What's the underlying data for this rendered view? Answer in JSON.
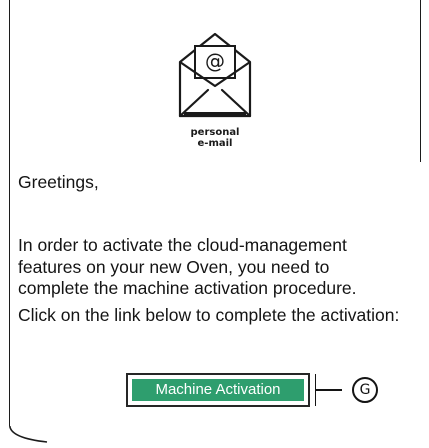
{
  "icon": {
    "name": "envelope-at-icon",
    "glyph": "@",
    "caption_lines": [
      "personal",
      "e-mail"
    ]
  },
  "email": {
    "greeting": "Greetings,",
    "body_lines": [
      "In order to activate the cloud-management",
      "features on your new Oven, you need to",
      "complete the machine activation procedure."
    ],
    "instruction": "Click on the link below to complete the activation:"
  },
  "activation_button": {
    "label": "Machine Activation",
    "background_color": "#2e9e6e",
    "text_color": "#ffffff"
  },
  "callout": {
    "letter": "G"
  }
}
